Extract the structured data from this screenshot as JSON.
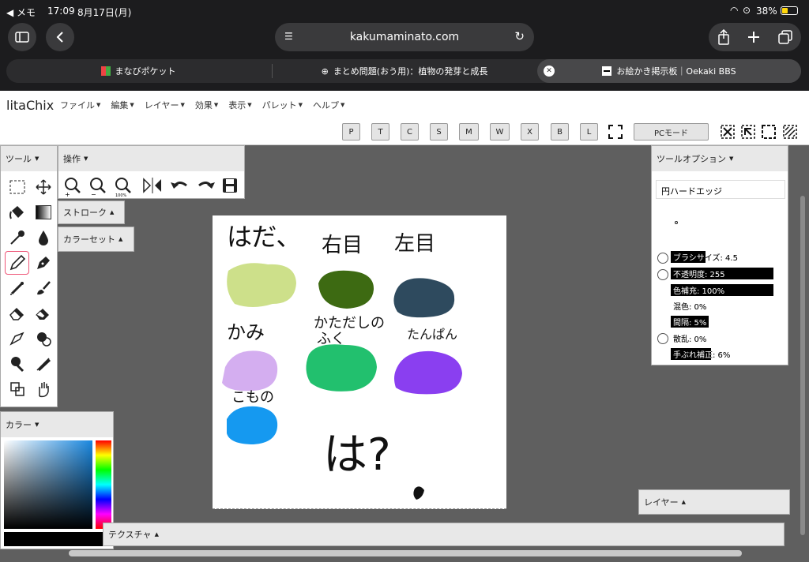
{
  "status": {
    "app_back": "◀ メモ",
    "time": "17:09",
    "date": "8月17日(月)",
    "battery": "38%"
  },
  "browser": {
    "url": "kakumaminato.com",
    "tabs": [
      {
        "label": "まなびポケット"
      },
      {
        "label": "まとめ問題(おう用)：植物の発芽と成長"
      },
      {
        "label": "お絵かき掲示板｜Oekaki BBS"
      }
    ]
  },
  "app": {
    "name": "litaChix",
    "menus": [
      "ファイル",
      "編集",
      "レイヤー",
      "効果",
      "表示",
      "パレット",
      "ヘルプ"
    ],
    "shortcut_keys": [
      "P",
      "T",
      "C",
      "S",
      "M",
      "W",
      "X",
      "B",
      "L"
    ],
    "pc_mode": "PCモード"
  },
  "panels": {
    "tools": "ツール",
    "ops": "操作",
    "stroke": "ストローク",
    "colorset": "カラーセット",
    "tool_options": "ツールオプション",
    "layer": "レイヤー",
    "color": "カラー",
    "texture": "テクスチャ"
  },
  "tool_options": {
    "brush_name": "円ハードエッジ",
    "brush_size": {
      "label": "ブラシサイズ: 4.5",
      "fill": 0.34
    },
    "opacity": {
      "label": "不透明度: 255",
      "fill": 1.0
    },
    "color_fill": {
      "label": "色補充: 100%",
      "fill": 1.0
    },
    "mix": {
      "label": "混色: 0%",
      "fill": 0
    },
    "spacing": {
      "label": "間隔: 5%",
      "fill": 0.37
    },
    "scatter": {
      "label": "散乱: 0%",
      "fill": 0
    },
    "stabilizer": {
      "label": "手ぶれ補正: 6%",
      "fill": 0.39
    }
  },
  "canvas_text": {
    "hada": "はだ、",
    "migime": "右目",
    "hidarime": "左目",
    "kami": "かみ",
    "katadashi1": "かただしの",
    "katadashi2": "ふく",
    "tanpan": "たんぱん",
    "komono": "こもの",
    "ha": "は?"
  },
  "colors": {
    "skin": "#cde08a",
    "right_eye": "#3d6a12",
    "left_eye": "#2e4a5e",
    "hair": "#d4aef0",
    "shirt": "#22c06e",
    "shorts": "#8a3ff0",
    "accessory": "#1599f0"
  }
}
